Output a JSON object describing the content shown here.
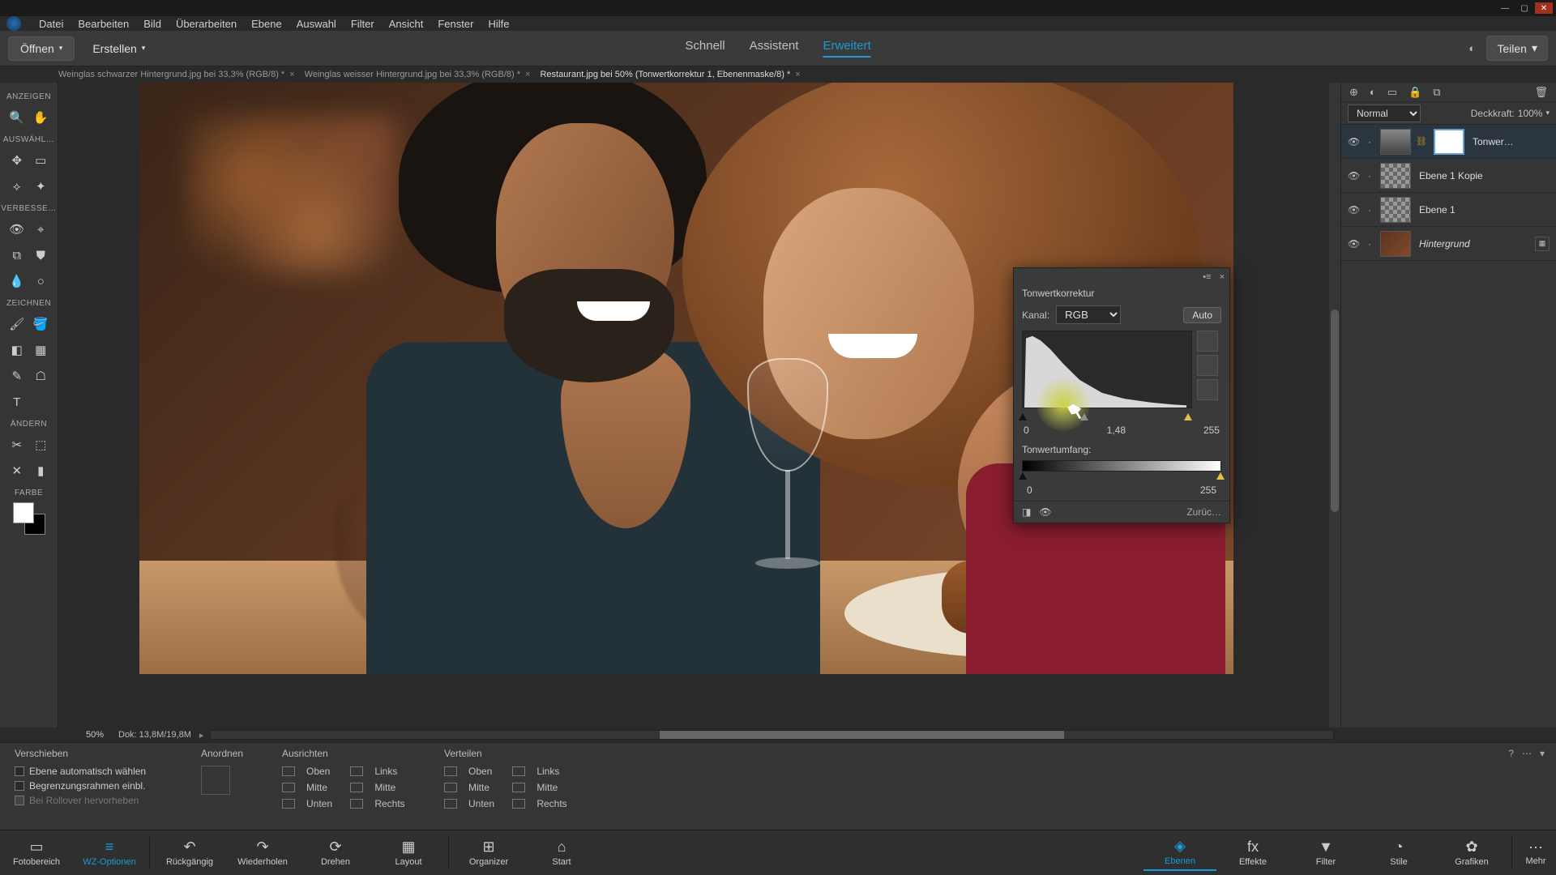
{
  "window": {
    "minimize": "—",
    "maximize": "▢",
    "close": "✕"
  },
  "menu": {
    "items": [
      "Datei",
      "Bearbeiten",
      "Bild",
      "Überarbeiten",
      "Ebene",
      "Auswahl",
      "Filter",
      "Ansicht",
      "Fenster",
      "Hilfe"
    ]
  },
  "topbar": {
    "open": "Öffnen",
    "create": "Erstellen",
    "modes": {
      "quick": "Schnell",
      "assistant": "Assistent",
      "advanced": "Erweitert"
    },
    "share": "Teilen"
  },
  "tabs": [
    {
      "label": "Weinglas schwarzer Hintergrund.jpg bei 33,3% (RGB/8) *",
      "active": false
    },
    {
      "label": "Weinglas weisser Hintergrund.jpg bei 33,3% (RGB/8) *",
      "active": false
    },
    {
      "label": "Restaurant.jpg bei 50% (Tonwertkorrektur 1, Ebenenmaske/8) *",
      "active": true
    }
  ],
  "left": {
    "anzeigen": "ANZEIGEN",
    "auswahl": "AUSWÄHL…",
    "verbesse": "VERBESSE…",
    "zeichnen": "ZEICHNEN",
    "aendern": "ÄNDERN",
    "farbe": "FARBE"
  },
  "status": {
    "zoom": "50%",
    "doc": "Dok: 13,8M/19,8M"
  },
  "options": {
    "title": "Verschieben",
    "chk1": "Ebene automatisch wählen",
    "chk2": "Begrenzungsrahmen einbl.",
    "chk3": "Bei Rollover hervorheben",
    "anordnen": "Anordnen",
    "ausrichten": "Ausrichten",
    "verteilen": "Verteilen",
    "oben": "Oben",
    "mitte": "Mitte",
    "unten": "Unten",
    "links": "Links",
    "rechts": "Rechts"
  },
  "layers": {
    "blend_mode": "Normal",
    "opacity_label": "Deckkraft:",
    "opacity_value": "100%",
    "items": [
      {
        "name": "Tonwer…",
        "kind": "adjust",
        "active": true
      },
      {
        "name": "Ebene 1 Kopie",
        "kind": "checker"
      },
      {
        "name": "Ebene 1",
        "kind": "checker"
      },
      {
        "name": "Hintergrund",
        "kind": "img",
        "italic": true,
        "fx": true
      }
    ]
  },
  "levels": {
    "title": "Tonwertkorrektur",
    "channel_label": "Kanal:",
    "channel_value": "RGB",
    "auto": "Auto",
    "in_black": "0",
    "in_gamma": "1,48",
    "in_white": "255",
    "output_label": "Tonwertumfang:",
    "out_black": "0",
    "out_white": "255",
    "reset": "Zurüc…"
  },
  "bottombar": {
    "left": [
      {
        "label": "Fotobereich",
        "icon": "▭"
      },
      {
        "label": "WZ-Optionen",
        "icon": "≡",
        "active": true
      },
      {
        "label": "Rückgängig",
        "icon": "↶"
      },
      {
        "label": "Wiederholen",
        "icon": "↷"
      },
      {
        "label": "Drehen",
        "icon": "⟳"
      },
      {
        "label": "Layout",
        "icon": "▦"
      }
    ],
    "mid": [
      {
        "label": "Organizer",
        "icon": "⊞"
      },
      {
        "label": "Start",
        "icon": "⌂"
      }
    ],
    "right": [
      {
        "label": "Ebenen",
        "icon": "◈",
        "active": true
      },
      {
        "label": "Effekte",
        "icon": "fx"
      },
      {
        "label": "Filter",
        "icon": "▼"
      },
      {
        "label": "Stile",
        "icon": "◔"
      },
      {
        "label": "Grafiken",
        "icon": "✿"
      }
    ],
    "more": "Mehr"
  }
}
